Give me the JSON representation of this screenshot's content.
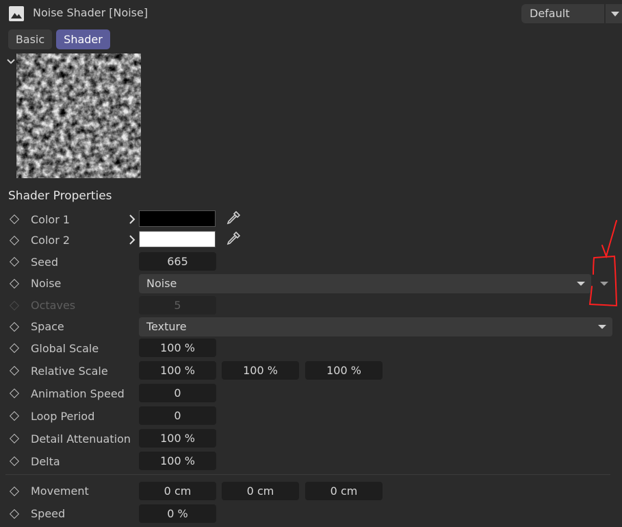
{
  "header": {
    "title": "Noise Shader [Noise]",
    "preset": "Default"
  },
  "tabs": [
    {
      "label": "Basic",
      "active": false
    },
    {
      "label": "Shader",
      "active": true
    }
  ],
  "section_title": "Shader Properties",
  "properties": {
    "color1": {
      "label": "Color 1",
      "color": "#000000"
    },
    "color2": {
      "label": "Color 2",
      "color": "#ffffff"
    },
    "seed": {
      "label": "Seed",
      "value": "665"
    },
    "noise": {
      "label": "Noise",
      "value": "Noise"
    },
    "octaves": {
      "label": "Octaves",
      "value": "5",
      "enabled": false
    },
    "space": {
      "label": "Space",
      "value": "Texture"
    },
    "global_scale": {
      "label": "Global Scale",
      "value": "100 %"
    },
    "relative_scale": {
      "label": "Relative Scale",
      "values": [
        "100 %",
        "100 %",
        "100 %"
      ]
    },
    "animation_speed": {
      "label": "Animation Speed",
      "value": "0"
    },
    "loop_period": {
      "label": "Loop Period",
      "value": "0"
    },
    "detail_attenuation": {
      "label": "Detail Attenuation",
      "value": "100 %"
    },
    "delta": {
      "label": "Delta",
      "value": "100 %"
    },
    "movement": {
      "label": "Movement",
      "values": [
        "0 cm",
        "0 cm",
        "0 cm"
      ]
    },
    "speed": {
      "label": "Speed",
      "value": "0 %"
    }
  },
  "colors": {
    "background": "#2b2b2b",
    "field": "#1e1e1e",
    "active_tab": "#5b5c9a",
    "annotation": "#ff2020"
  },
  "icons": [
    "image-icon",
    "chevron-down-icon",
    "chevron-right-icon",
    "eyedropper-icon",
    "keyframe-diamond-icon",
    "dropdown-arrow-icon"
  ]
}
